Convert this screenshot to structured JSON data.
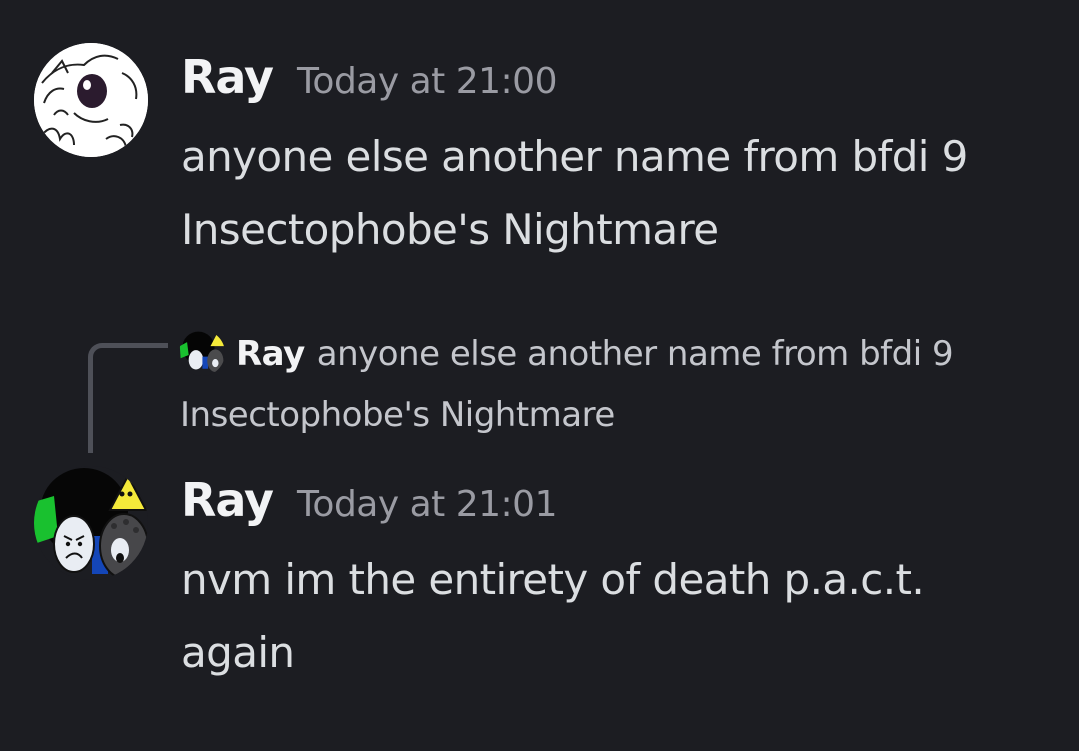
{
  "messages": [
    {
      "username": "Ray",
      "timestamp": "Today at 21:00",
      "lines": [
        "anyone else another name from bfdi 9",
        "Insectophobe's Nightmare"
      ]
    },
    {
      "username": "Ray",
      "timestamp": "Today at 21:01",
      "lines": [
        "nvm im the entirety of death p.a.c.t.",
        "again"
      ],
      "reply": {
        "username": "Ray",
        "line1": "anyone else another name from bfdi 9",
        "line2": "Insectophobe's Nightmare"
      }
    }
  ],
  "colors": {
    "background": "#1c1d22",
    "username": "#f2f3f5",
    "timestamp": "#9a9ba3",
    "text": "#dbdee1",
    "reply_spine": "#4e5058"
  },
  "icons": {
    "first_avatar": "sketch-character-avatar-icon",
    "second_avatar": "object-characters-group-avatar-icon"
  }
}
